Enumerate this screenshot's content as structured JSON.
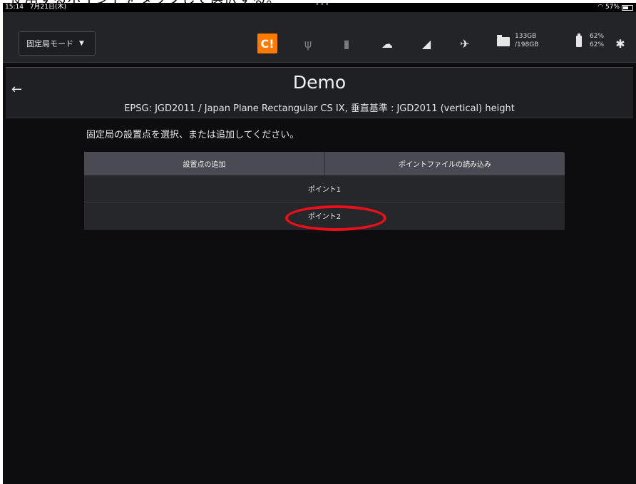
{
  "caption": "使用するポイントをタップして選択する。",
  "status_bar": {
    "time": "15:14",
    "date": "7月21日(木)",
    "dots": "•••",
    "battery": "57%"
  },
  "app_bar": {
    "mode_label": "固定局モード",
    "icons": [
      "status-alert-icon",
      "usb-icon",
      "sd-card-icon",
      "cloud-icon",
      "signal-icon",
      "satellite-icon",
      "folder-icon",
      "battery-icon",
      "gear-icon"
    ],
    "storage_used": "133GB",
    "storage_total": "/198GB",
    "battery_1": "62%",
    "battery_2": "62%",
    "accent_color": "#ff7a00"
  },
  "header": {
    "title": "Demo",
    "subtitle": "EPSG: JGD2011 / Japan Plane Rectangular CS IX, 垂直基準 : JGD2011 (vertical) height"
  },
  "main": {
    "instruction": "固定局の設置点を選択、または追加してください。",
    "add_button": "設置点の追加",
    "load_button": "ポイントファイルの読み込み",
    "points": [
      "ポイント1",
      "ポイント2"
    ],
    "highlight_color": "#e8101a"
  }
}
